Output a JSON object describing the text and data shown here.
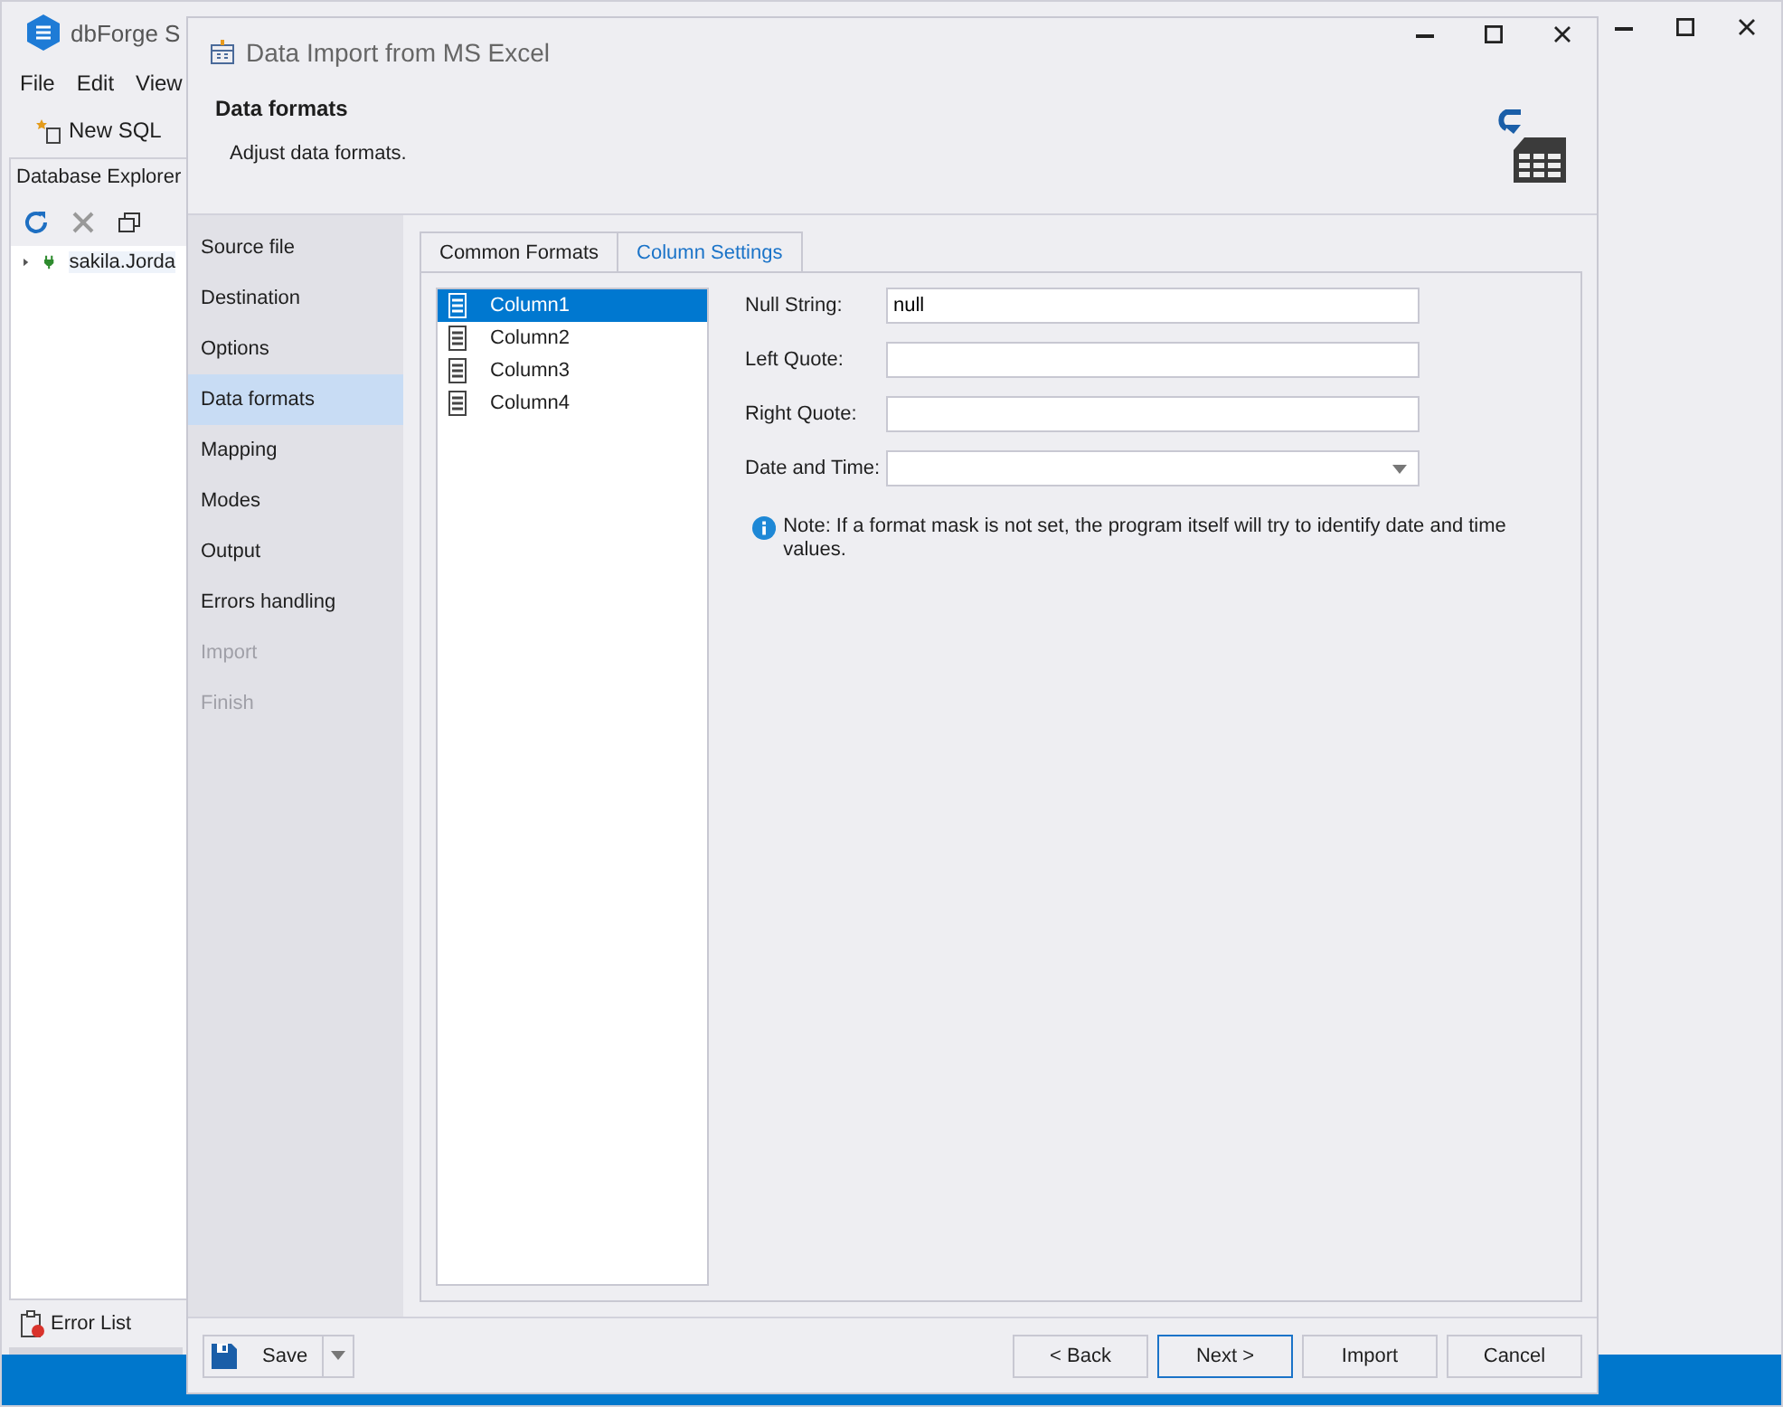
{
  "app": {
    "title": "dbForge S",
    "menu": [
      "File",
      "Edit",
      "View"
    ],
    "toolbar": [
      "New SQL"
    ],
    "explorer": {
      "title": "Database Explorer",
      "tree": [
        {
          "label": "sakila.Jorda",
          "expanded": false
        }
      ]
    },
    "bottom_tab": "Error List"
  },
  "dialog": {
    "title": "Data Import from MS Excel",
    "header": {
      "title": "Data formats",
      "subtitle": "Adjust data formats."
    },
    "steps": [
      {
        "label": "Source file",
        "selected": false,
        "disabled": false
      },
      {
        "label": "Destination",
        "selected": false,
        "disabled": false
      },
      {
        "label": "Options",
        "selected": false,
        "disabled": false
      },
      {
        "label": "Data formats",
        "selected": true,
        "disabled": false
      },
      {
        "label": "Mapping",
        "selected": false,
        "disabled": false
      },
      {
        "label": "Modes",
        "selected": false,
        "disabled": false
      },
      {
        "label": "Output",
        "selected": false,
        "disabled": false
      },
      {
        "label": "Errors handling",
        "selected": false,
        "disabled": false
      },
      {
        "label": "Import",
        "selected": false,
        "disabled": true
      },
      {
        "label": "Finish",
        "selected": false,
        "disabled": true
      }
    ],
    "tabs": [
      {
        "label": "Common Formats",
        "selected": false
      },
      {
        "label": "Column Settings",
        "selected": true
      }
    ],
    "columns": [
      {
        "label": "Column1",
        "selected": true
      },
      {
        "label": "Column2",
        "selected": false
      },
      {
        "label": "Column3",
        "selected": false
      },
      {
        "label": "Column4",
        "selected": false
      }
    ],
    "fields": [
      {
        "kind": "text",
        "label": "Null String:",
        "value": "null"
      },
      {
        "kind": "text",
        "label": "Left Quote:"
      },
      {
        "kind": "text",
        "label": "Right Quote:"
      },
      {
        "kind": "dropdown",
        "label": "Date and Time:"
      }
    ],
    "note": "Note: If a format mask is not set, the program itself will try to identify date and time values.",
    "save_button": "Save",
    "buttons": [
      {
        "label": "< Back",
        "default": false
      },
      {
        "label": "Next >",
        "default": true
      },
      {
        "label": "Import",
        "default": false
      },
      {
        "label": "Cancel",
        "default": false
      }
    ]
  }
}
